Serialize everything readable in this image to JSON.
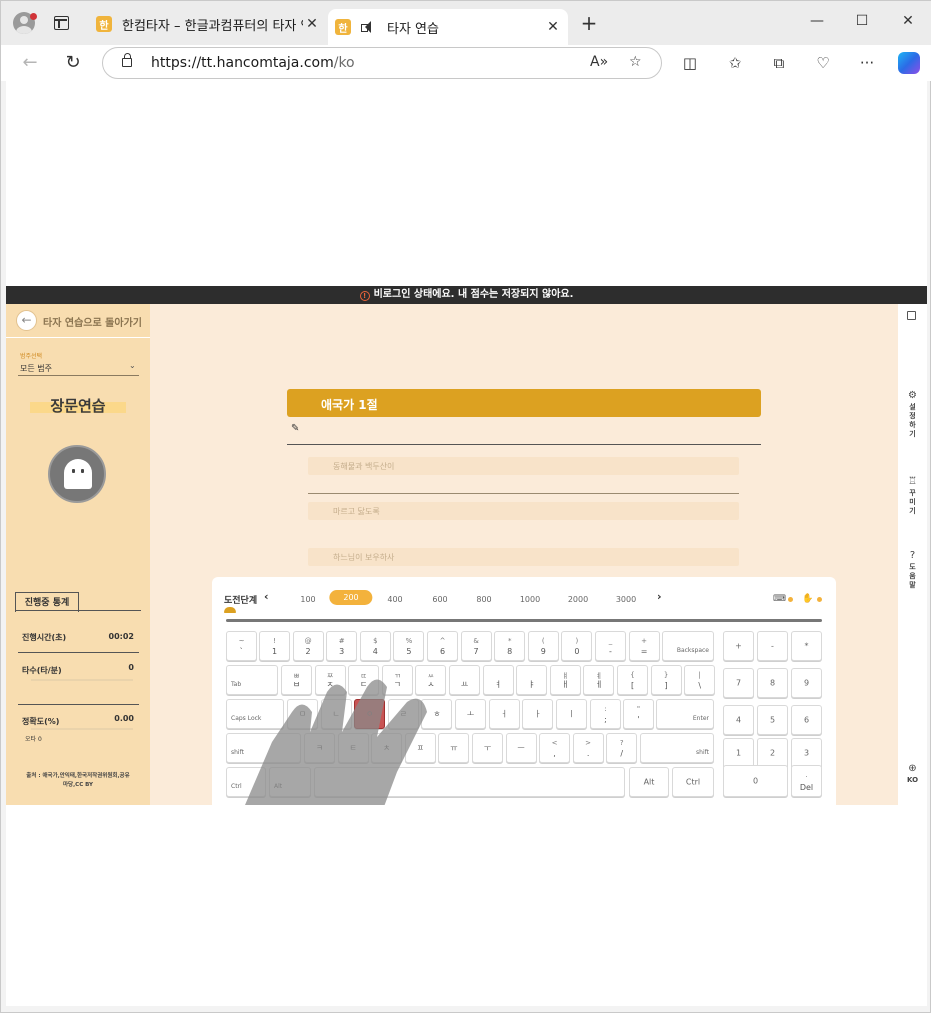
{
  "browser": {
    "tabs": [
      {
        "favicon": "한",
        "title": "한컴타자 – 한글과컴퓨터의 타자 연습"
      },
      {
        "favicon": "한",
        "title": "타자 연습"
      }
    ],
    "window_controls": {
      "minimize": "—",
      "maximize": "☐",
      "close": "✕"
    },
    "url": "https://tt.hancomtaja.com/ko",
    "url_host": "https://tt.hancomtaja.com",
    "url_path": "/ko"
  },
  "banner": {
    "text": "비로그인 상태에요. 내 점수는 저장되지 않아요."
  },
  "sidebar": {
    "back_label": "타자 연습으로 돌아가기",
    "range_caption": "범주선택",
    "range_value": "모든 범주",
    "mode_title": "장문연습",
    "stats_tab": "진행중 통계",
    "stats": {
      "time_label": "진행시간(초)",
      "time_value": "00:02",
      "speed_label": "타수(타/분)",
      "speed_value": "0",
      "accuracy_label": "정확도(%)",
      "accuracy_value": "0.00",
      "typo_label": "오타 0"
    },
    "source": "출처 : 애국가,안익태,한국저작권위원회,공유마당,CC BY"
  },
  "main": {
    "passage_title": "애국가 1절",
    "lines": [
      "동해물과 백두산이",
      "마르고 닳도록",
      "하느님이 보우하사"
    ]
  },
  "keyboard": {
    "level_label": "도전단계",
    "levels": [
      "100",
      "200",
      "400",
      "600",
      "800",
      "1000",
      "2000",
      "3000"
    ],
    "active_level": "200",
    "keys": {
      "row1": [
        [
          "~",
          "`"
        ],
        [
          "!",
          "1"
        ],
        [
          "@",
          "2"
        ],
        [
          "#",
          "3"
        ],
        [
          "$",
          "4"
        ],
        [
          "%",
          "5"
        ],
        [
          "^",
          "6"
        ],
        [
          "&",
          "7"
        ],
        [
          "*",
          "8"
        ],
        [
          "(",
          "9"
        ],
        [
          ")",
          "0"
        ],
        [
          "_",
          "-"
        ],
        [
          "+",
          "="
        ]
      ],
      "backspace": "Backspace",
      "tab": "Tab",
      "row2": [
        [
          "ㅃ",
          "ㅂ"
        ],
        [
          "ㅉ",
          "ㅈ"
        ],
        [
          "ㄸ",
          "ㄷ"
        ],
        [
          "ㄲ",
          "ㄱ"
        ],
        [
          "ㅆ",
          "ㅅ"
        ],
        [
          "",
          "ㅛ"
        ],
        [
          "",
          "ㅕ"
        ],
        [
          "",
          "ㅑ"
        ],
        [
          "ㅒ",
          "ㅐ"
        ],
        [
          "ㅖ",
          "ㅔ"
        ],
        [
          "{",
          "["
        ],
        [
          "}",
          "]"
        ],
        [
          "|",
          "\\"
        ]
      ],
      "caps": "Caps Lock",
      "row3": [
        "ㅁ",
        "ㄴ",
        "ㅇ",
        "ㄹ",
        "ㅎ",
        "ㅗ",
        "ㅓ",
        "ㅏ",
        "ㅣ"
      ],
      "row3_punct": [
        [
          ":",
          ";"
        ],
        [
          "\"",
          "'"
        ]
      ],
      "enter": "Enter",
      "shift": "shift",
      "row4": [
        "ㅋ",
        "ㅌ",
        "ㅊ",
        "ㅍ",
        "ㅠ",
        "ㅜ",
        "ㅡ"
      ],
      "row4_punct": [
        [
          "<",
          ","
        ],
        [
          ">",
          "."
        ],
        [
          "?",
          "/"
        ]
      ],
      "ctrl": "Ctrl",
      "alt": "Alt",
      "numpad": [
        "+",
        "-",
        "*",
        "7",
        "8",
        "9",
        "4",
        "5",
        "6",
        "1",
        "2",
        "3",
        "0"
      ],
      "del_top": ".",
      "del": "Del"
    }
  },
  "right_rail": {
    "settings": "설정하기",
    "decorate": "꾸미기",
    "help": "도움말",
    "lang": "KO"
  }
}
